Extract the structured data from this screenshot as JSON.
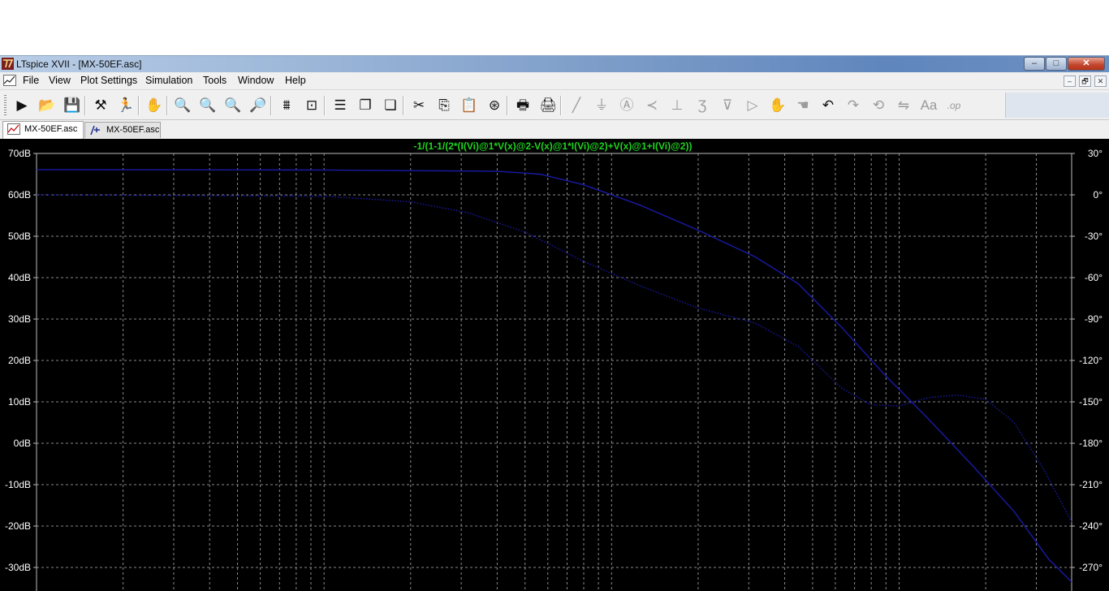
{
  "window": {
    "title": "LTspice XVII - [MX-50EF.asc]",
    "min": "–",
    "max": "□",
    "close": "✕"
  },
  "menu": [
    "File",
    "View",
    "Plot Settings",
    "Simulation",
    "Tools",
    "Window",
    "Help"
  ],
  "mdi_buttons": [
    "–",
    "🗗",
    "✕"
  ],
  "toolbar": [
    {
      "name": "run-icon",
      "glyph": "▶",
      "enabled": true
    },
    {
      "name": "open-icon",
      "glyph": "📂",
      "enabled": true
    },
    {
      "name": "save-icon",
      "glyph": "💾",
      "enabled": true
    },
    {
      "name": "control-panel-icon",
      "glyph": "⚒",
      "enabled": true
    },
    {
      "name": "halt-icon",
      "glyph": "🏃",
      "enabled": true
    },
    {
      "name": "pan-icon",
      "glyph": "✋",
      "enabled": false
    },
    {
      "name": "zoom-in-icon",
      "glyph": "🔍",
      "enabled": true
    },
    {
      "name": "zoom-area-icon",
      "glyph": "🔍",
      "enabled": true
    },
    {
      "name": "zoom-out-icon",
      "glyph": "🔍",
      "enabled": true
    },
    {
      "name": "zoom-cancel-icon",
      "glyph": "🔎",
      "enabled": true
    },
    {
      "name": "autorange-icon",
      "glyph": "⩩",
      "enabled": true
    },
    {
      "name": "mark-unref-icon",
      "glyph": "⊡",
      "enabled": true
    },
    {
      "name": "tile-horizontal-icon",
      "glyph": "☰",
      "enabled": true
    },
    {
      "name": "cascade-icon",
      "glyph": "❐",
      "enabled": true
    },
    {
      "name": "tile-vertical-icon",
      "glyph": "❏",
      "enabled": true
    },
    {
      "name": "cut-icon",
      "glyph": "✂",
      "enabled": true
    },
    {
      "name": "copy-icon",
      "glyph": "⎘",
      "enabled": true
    },
    {
      "name": "paste-icon",
      "glyph": "📋",
      "enabled": true
    },
    {
      "name": "find-icon",
      "glyph": "⊛",
      "enabled": true
    },
    {
      "name": "print-preview-icon",
      "glyph": "🖶",
      "enabled": true
    },
    {
      "name": "print-icon",
      "glyph": "🖨",
      "enabled": true
    },
    {
      "name": "wire-icon",
      "glyph": "╱",
      "enabled": false
    },
    {
      "name": "ground-icon",
      "glyph": "⏚",
      "enabled": false
    },
    {
      "name": "label-net-icon",
      "glyph": "Ⓐ",
      "enabled": false
    },
    {
      "name": "resistor-icon",
      "glyph": "≺",
      "enabled": false
    },
    {
      "name": "capacitor-icon",
      "glyph": "⊥",
      "enabled": false
    },
    {
      "name": "inductor-icon",
      "glyph": "Ʒ",
      "enabled": false
    },
    {
      "name": "diode-icon",
      "glyph": "⊽",
      "enabled": false
    },
    {
      "name": "component-icon",
      "glyph": "▷",
      "enabled": false
    },
    {
      "name": "move-icon",
      "glyph": "✋",
      "enabled": false
    },
    {
      "name": "drag-icon",
      "glyph": "☚",
      "enabled": false
    },
    {
      "name": "undo-icon",
      "glyph": "↶",
      "enabled": true
    },
    {
      "name": "redo-icon",
      "glyph": "↷",
      "enabled": false
    },
    {
      "name": "rotate-icon",
      "glyph": "⟲",
      "enabled": false
    },
    {
      "name": "mirror-icon",
      "glyph": "⇋",
      "enabled": false
    },
    {
      "name": "text-icon",
      "glyph": "Aa",
      "enabled": false
    },
    {
      "name": "spice-directive-icon",
      "glyph": ".op",
      "enabled": false
    }
  ],
  "tabs": [
    {
      "label": "MX-50EF.asc",
      "kind": "plot",
      "active": true
    },
    {
      "label": "MX-50EF.asc",
      "kind": "schematic",
      "active": false
    }
  ],
  "colors": {
    "plot_bg": "#000000",
    "grid": "#8a8a8a",
    "axis_text": "#ffffff",
    "trace": "#1a1aa8",
    "expr_text": "#1fd41f"
  },
  "chart_data": {
    "type": "line",
    "title": "-1/(1-1/(2*(I(Vi)@1*V(x)@2-V(x)@1*I(Vi)@2)+V(x)@1+I(Vi)@2))",
    "x_scale": "log",
    "xlim_decades": [
      0,
      3.6
    ],
    "yleft_label_suffix": "dB",
    "yleft_ticks": [
      70,
      60,
      50,
      40,
      30,
      20,
      10,
      0,
      -10,
      -20,
      -30
    ],
    "yleft_tick_labels": [
      "70dB",
      "60dB",
      "50dB",
      "40dB",
      "30dB",
      "20dB",
      "10dB",
      "0dB",
      "-10dB",
      "-20dB",
      "-30dB"
    ],
    "yright_ticks": [
      30,
      0,
      -30,
      -60,
      -90,
      -120,
      -150,
      -180,
      -210,
      -240,
      -270
    ],
    "yright_tick_labels": [
      "30°",
      "0°",
      "-30°",
      "-60°",
      "-90°",
      "-120°",
      "-150°",
      "-180°",
      "-210°",
      "-240°",
      "-270°"
    ],
    "grid": true,
    "series": [
      {
        "style": "solid",
        "x": [
          0,
          1.0,
          1.6,
          1.75,
          1.9,
          2.1,
          2.3,
          2.5,
          2.65,
          2.8,
          2.95,
          3.1,
          3.25,
          3.4,
          3.52,
          3.6
        ],
        "y": [
          66.1,
          66.0,
          65.7,
          65.0,
          62.5,
          57.5,
          51.5,
          45.0,
          38.5,
          28.0,
          16.5,
          6.0,
          -5.0,
          -16.5,
          -28.0,
          -33.5
        ]
      },
      {
        "style": "dotted",
        "x": [
          0,
          1.0,
          1.3,
          1.5,
          1.7,
          1.9,
          2.1,
          2.3,
          2.5,
          2.65,
          2.8,
          2.9,
          3.0,
          3.1,
          3.2,
          3.3,
          3.4,
          3.5,
          3.6
        ],
        "y": [
          0,
          -1,
          -5,
          -13,
          -27,
          -48,
          -66,
          -82,
          -93,
          -110,
          -140,
          -152,
          -153,
          -147,
          -145,
          -148,
          -165,
          -198,
          -237
        ]
      }
    ]
  }
}
